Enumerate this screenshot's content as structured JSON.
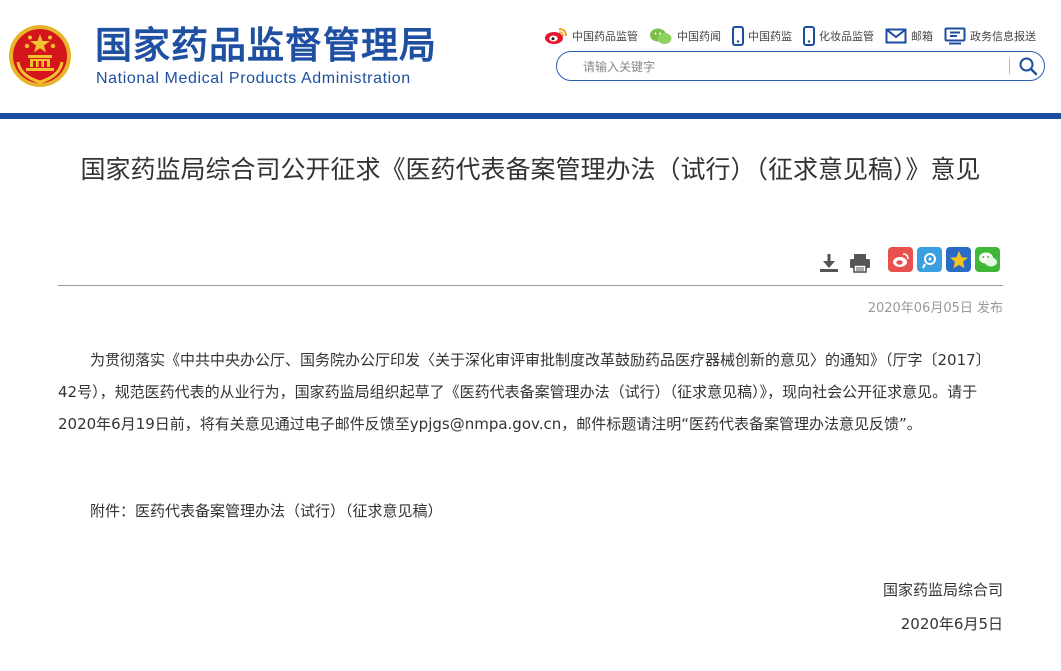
{
  "header": {
    "site_name_cn": "国家药品监督管理局",
    "site_name_en": "National Medical Products Administration",
    "links": [
      {
        "label": "中国药品监管",
        "icon": "weibo-icon"
      },
      {
        "label": "中国药闻",
        "icon": "wechat-icon"
      },
      {
        "label": "中国药监",
        "icon": "mobile-icon"
      },
      {
        "label": "化妆品监管",
        "icon": "mobile-icon"
      },
      {
        "label": "邮箱",
        "icon": "mail-icon"
      },
      {
        "label": "政务信息报送",
        "icon": "monitor-icon"
      }
    ],
    "search": {
      "placeholder": "请输入关键字",
      "value": ""
    }
  },
  "article": {
    "title": "国家药监局综合司公开征求《医药代表备案管理办法（试行）（征求意见稿）》意见",
    "publish_date": "2020年06月05日 发布",
    "paragraph": "为贯彻落实《中共中央办公厅、国务院办公厅印发〈关于深化审评审批制度改革鼓励药品医疗器械创新的意见〉的通知》（厅字〔2017〕42号），规范医药代表的从业行为，国家药监局组织起草了《医药代表备案管理办法（试行）（征求意见稿）》，现向社会公开征求意见。请于2020年6月19日前，将有关意见通过电子邮件反馈至ypjgs@nmpa.gov.cn，邮件标题请注明“医药代表备案管理办法意见反馈”。",
    "attachment": "附件：医药代表备案管理办法（试行）（征求意见稿）",
    "signature_org": "国家药监局综合司",
    "signature_date": "2020年6月5日"
  },
  "tools": [
    "download-icon",
    "print-icon"
  ],
  "share_icons": [
    "weibo-share-icon",
    "tencent-weibo-share-icon",
    "qzone-share-icon",
    "wechat-share-icon"
  ],
  "colors": {
    "brand_blue": "#1c4ea0",
    "emblem_red": "#d4151c",
    "emblem_gold": "#f2c12e"
  }
}
